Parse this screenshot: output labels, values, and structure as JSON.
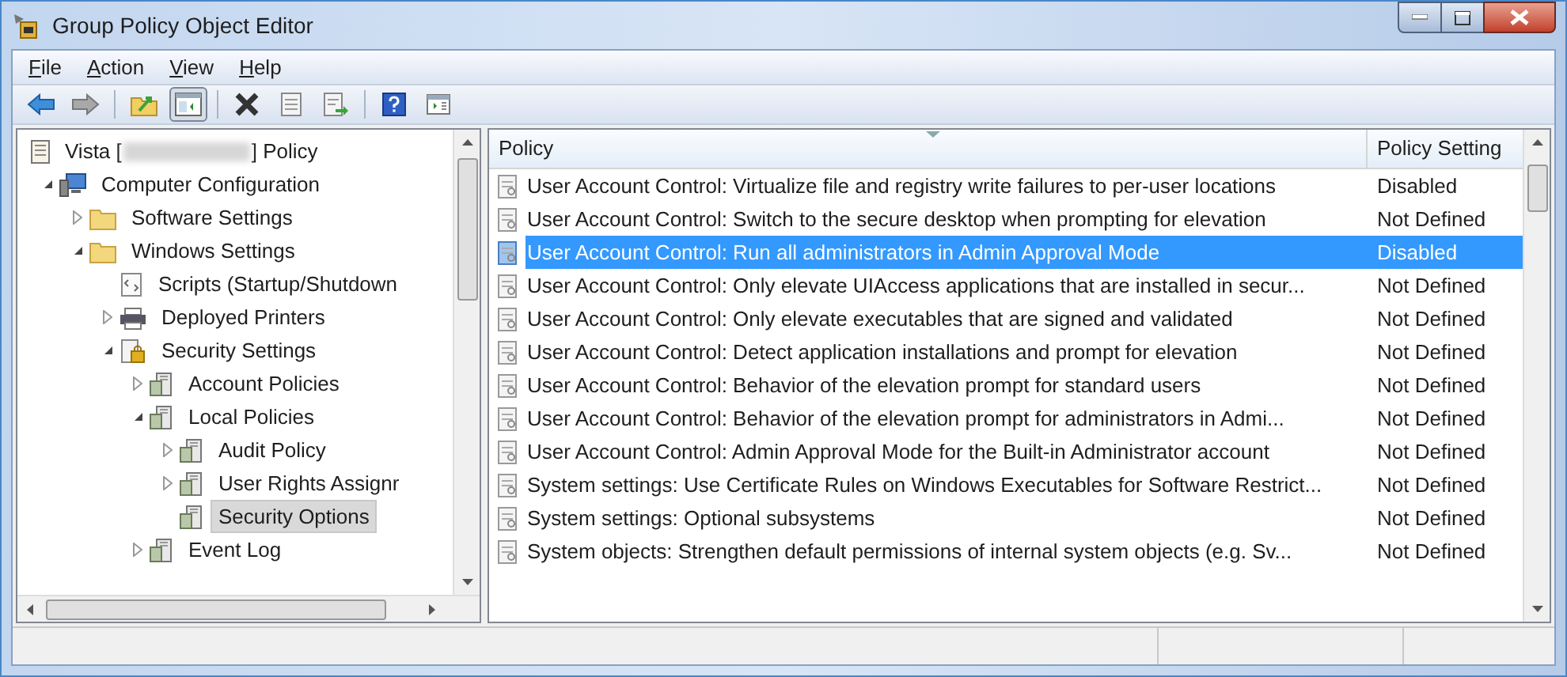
{
  "window": {
    "title": "Group Policy Object Editor"
  },
  "menu": [
    {
      "label": "File"
    },
    {
      "label": "Action"
    },
    {
      "label": "View"
    },
    {
      "label": "Help"
    }
  ],
  "toolbar": [
    {
      "kind": "back",
      "pressed": false
    },
    {
      "kind": "forward",
      "pressed": false
    },
    {
      "kind": "separator"
    },
    {
      "kind": "up",
      "pressed": false
    },
    {
      "kind": "tree",
      "pressed": true
    },
    {
      "kind": "separator"
    },
    {
      "kind": "delete",
      "pressed": false
    },
    {
      "kind": "properties",
      "pressed": false
    },
    {
      "kind": "export",
      "pressed": false
    },
    {
      "kind": "separator"
    },
    {
      "kind": "help",
      "pressed": false
    },
    {
      "kind": "panel",
      "pressed": false
    }
  ],
  "tree": {
    "label_start": "Vista [",
    "label_end": "] Policy",
    "kind": "policy",
    "selected": false,
    "children": [
      {
        "label": "Computer Configuration",
        "kind": "computer",
        "expanded": true,
        "selected": false,
        "children": [
          {
            "label": "Software Settings",
            "kind": "folder",
            "expanded": false,
            "selected": false
          },
          {
            "label": "Windows Settings",
            "kind": "folder",
            "expanded": true,
            "selected": false,
            "children": [
              {
                "label": "Scripts (Startup/Shutdown",
                "kind": "script",
                "selected": false
              },
              {
                "label": "Deployed Printers",
                "kind": "printer",
                "expanded": false,
                "selected": false
              },
              {
                "label": "Security Settings",
                "kind": "security",
                "expanded": true,
                "selected": false,
                "children": [
                  {
                    "label": "Account Policies",
                    "kind": "server",
                    "expanded": false,
                    "selected": false
                  },
                  {
                    "label": "Local Policies",
                    "kind": "server",
                    "expanded": true,
                    "selected": false,
                    "children": [
                      {
                        "label": "Audit Policy",
                        "kind": "server",
                        "expanded": false,
                        "selected": false
                      },
                      {
                        "label": "User Rights Assignr",
                        "kind": "server",
                        "expanded": false,
                        "selected": false
                      },
                      {
                        "label": "Security Options",
                        "kind": "server",
                        "selected": true
                      }
                    ]
                  },
                  {
                    "label": "Event Log",
                    "kind": "server",
                    "expanded": false,
                    "selected": false
                  }
                ]
              }
            ]
          }
        ]
      }
    ]
  },
  "table": {
    "columns": [
      "Policy",
      "Policy Setting"
    ],
    "rows": [
      {
        "policy": "User Account Control: Virtualize file and registry write failures to per-user locations",
        "setting": "Disabled",
        "selected": false
      },
      {
        "policy": "User Account Control: Switch to the secure desktop when prompting for elevation",
        "setting": "Not Defined",
        "selected": false
      },
      {
        "policy": "User Account Control: Run all administrators in Admin Approval Mode",
        "setting": "Disabled",
        "selected": true
      },
      {
        "policy": "User Account Control: Only elevate UIAccess applications that are installed in secur...",
        "setting": "Not Defined",
        "selected": false
      },
      {
        "policy": "User Account Control: Only elevate executables that are signed and validated",
        "setting": "Not Defined",
        "selected": false
      },
      {
        "policy": "User Account Control: Detect application installations and prompt for elevation",
        "setting": "Not Defined",
        "selected": false
      },
      {
        "policy": "User Account Control: Behavior of the elevation prompt for standard users",
        "setting": "Not Defined",
        "selected": false
      },
      {
        "policy": "User Account Control: Behavior of the elevation prompt for administrators in Admi...",
        "setting": "Not Defined",
        "selected": false
      },
      {
        "policy": "User Account Control: Admin Approval Mode for the Built-in Administrator account",
        "setting": "Not Defined",
        "selected": false
      },
      {
        "policy": "System settings: Use Certificate Rules on Windows Executables for Software Restrict...",
        "setting": "Not Defined",
        "selected": false
      },
      {
        "policy": "System settings: Optional subsystems",
        "setting": "Not Defined",
        "selected": false
      },
      {
        "policy": "System objects: Strengthen default permissions of internal system objects (e.g. Sv...",
        "setting": "Not Defined",
        "selected": false
      }
    ]
  }
}
